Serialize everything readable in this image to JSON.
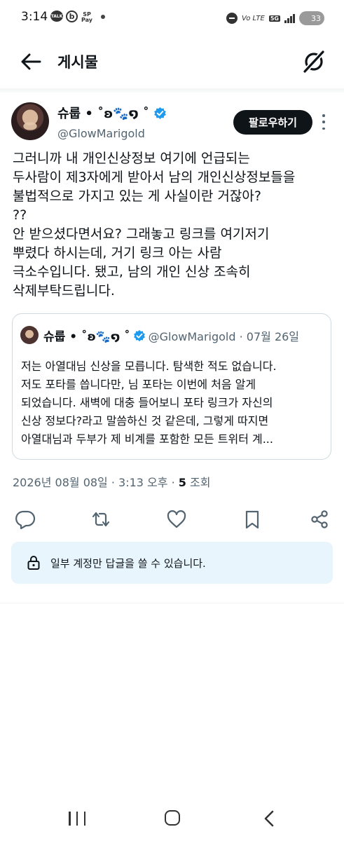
{
  "status_bar": {
    "time": "3:14",
    "talk_icon_text": "TALK",
    "b_icon_text": "b",
    "pay_icon_text": "SP Pay",
    "volte_text": "Vo LTE",
    "network": "5G",
    "battery": "33"
  },
  "header": {
    "title": "게시물"
  },
  "post": {
    "display_name": "슈룹 • ˚ʚ🐾໑ ˚",
    "handle": "@GlowMarigold",
    "follow_label": "팔로우하기",
    "text_lines": [
      "그러니까 내 개인신상정보 여기에 언급되는",
      "두사람이 제3자에게 받아서 남의 개인신상정보들을",
      "불법적으로 가지고 있는 게 사실이란 거잖아?",
      "??",
      "안 받으셨다면서요? 그래놓고 링크를 여기저기",
      "뿌렸다 하시는데, 거기 링크 아는 사람",
      "극소수입니다. 됐고, 남의 개인 신상 조속히",
      "삭제부탁드립니다."
    ],
    "timestamp": "2026년 08월 08일 · 3:13 오후 · ",
    "views_count": "5",
    "views_label": " 조회"
  },
  "quote": {
    "display_name": "슈룹 • ˚ʚ🐾໑ ˚",
    "handle_date": "@GlowMarigold · 07월 26일",
    "text_lines": [
      "저는 아열대님 신상을 모릅니다. 탐색한 적도 없습니다.",
      "저도 포타를 씁니다만, 님 포타는 이번에 처음 알게",
      "되었습니다. 새벽에 대충 들어보니 포타 링크가 자신의",
      "신상 정보다?라고 말씀하신 것 같은데, 그렇게 따지면",
      "아열대님과 두부가 제 비계를 포함한 모든 트위터 계..."
    ]
  },
  "actions": [
    "reply-icon",
    "repost-icon",
    "like-icon",
    "bookmark-icon",
    "share-icon"
  ],
  "reply_restriction": {
    "text": "일부 계정만 답글을 쓸 수 있습니다."
  },
  "colors": {
    "text": "#0f1419",
    "secondary": "#536471",
    "verified": "#1d9bf0",
    "follow_bg": "#0f1419",
    "restrict_bg": "#e8f5fd",
    "border": "#cfd9de"
  }
}
